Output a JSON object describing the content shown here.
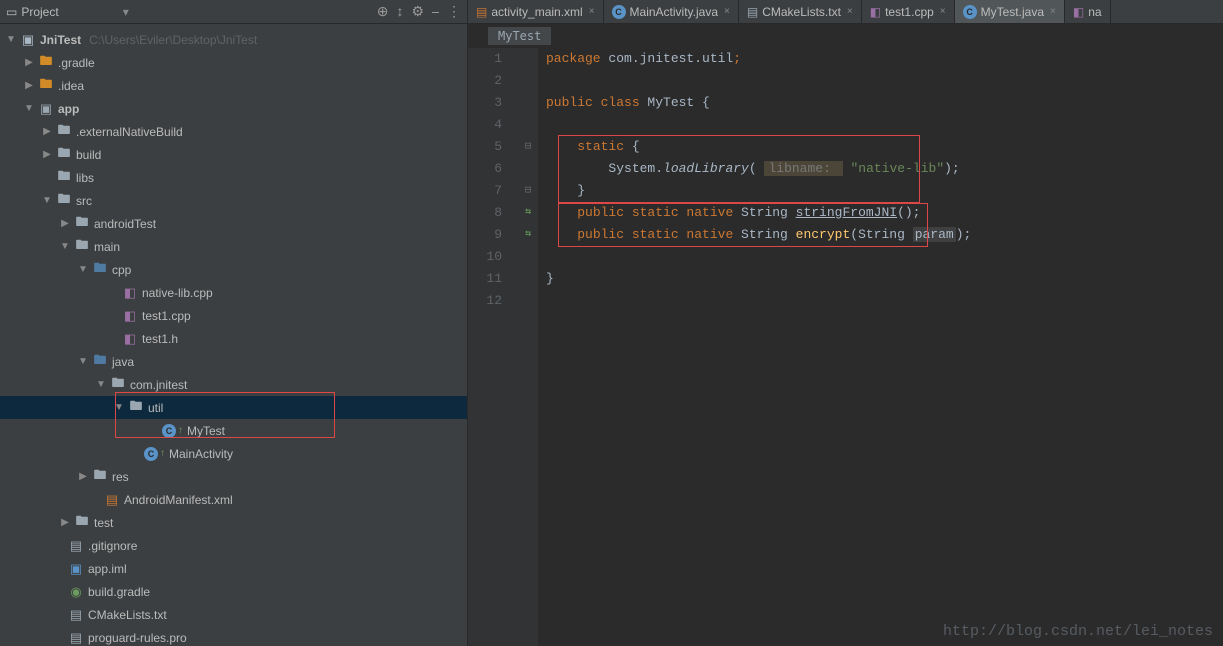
{
  "header": {
    "title": "Project",
    "tools": [
      "⊕",
      "↕",
      "⚙",
      "⎯",
      "⋮"
    ]
  },
  "root": {
    "name": "JniTest",
    "path": "C:\\Users\\Eviler\\Desktop\\JniTest"
  },
  "tree": [
    {
      "label": ".gradle"
    },
    {
      "label": ".idea"
    },
    {
      "label": "app"
    },
    {
      "label": ".externalNativeBuild"
    },
    {
      "label": "build"
    },
    {
      "label": "libs"
    },
    {
      "label": "src"
    },
    {
      "label": "androidTest"
    },
    {
      "label": "main"
    },
    {
      "label": "cpp"
    },
    {
      "label": "native-lib.cpp"
    },
    {
      "label": "test1.cpp"
    },
    {
      "label": "test1.h"
    },
    {
      "label": "java"
    },
    {
      "label": "com.jnitest"
    },
    {
      "label": "util"
    },
    {
      "label": "MyTest"
    },
    {
      "label": "MainActivity"
    },
    {
      "label": "res"
    },
    {
      "label": "AndroidManifest.xml"
    },
    {
      "label": "test"
    },
    {
      "label": ".gitignore"
    },
    {
      "label": "app.iml"
    },
    {
      "label": "build.gradle"
    },
    {
      "label": "CMakeLists.txt"
    },
    {
      "label": "proguard-rules.pro"
    }
  ],
  "tabs": [
    {
      "label": "activity_main.xml",
      "icon": "xml"
    },
    {
      "label": "MainActivity.java",
      "icon": "java"
    },
    {
      "label": "CMakeLists.txt",
      "icon": "file"
    },
    {
      "label": "test1.cpp",
      "icon": "cpp"
    },
    {
      "label": "MyTest.java",
      "icon": "java",
      "active": true
    },
    {
      "label": "na",
      "icon": "cpp"
    }
  ],
  "breadcrumb": "MyTest",
  "code": {
    "lines": [
      1,
      2,
      3,
      4,
      5,
      6,
      7,
      8,
      9,
      10,
      11,
      12
    ],
    "l1_kw": "package",
    "l1_pkg": " com.jnitest.util",
    "l1_semi": ";",
    "l3_kw": "public class ",
    "l3_name": "MyTest ",
    "l3_brace": "{",
    "l5_kw": "static ",
    "l5_brace": "{",
    "l6_sys": "System.",
    "l6_method": "loadLibrary",
    "l6_open": "( ",
    "l6_hint": "libname: ",
    "l6_str": "\"native-lib\"",
    "l6_close": ");",
    "l7_brace": "}",
    "l8_kw": "public static native ",
    "l8_type": "String ",
    "l8_method": "stringFromJNI",
    "l8_close": "();",
    "l9_kw": "public static native ",
    "l9_type": "String ",
    "l9_method": "encrypt",
    "l9_open": "(String ",
    "l9_param": "param",
    "l9_close": ");",
    "l11_brace": "}"
  },
  "watermark": "http://blog.csdn.net/lei_notes"
}
